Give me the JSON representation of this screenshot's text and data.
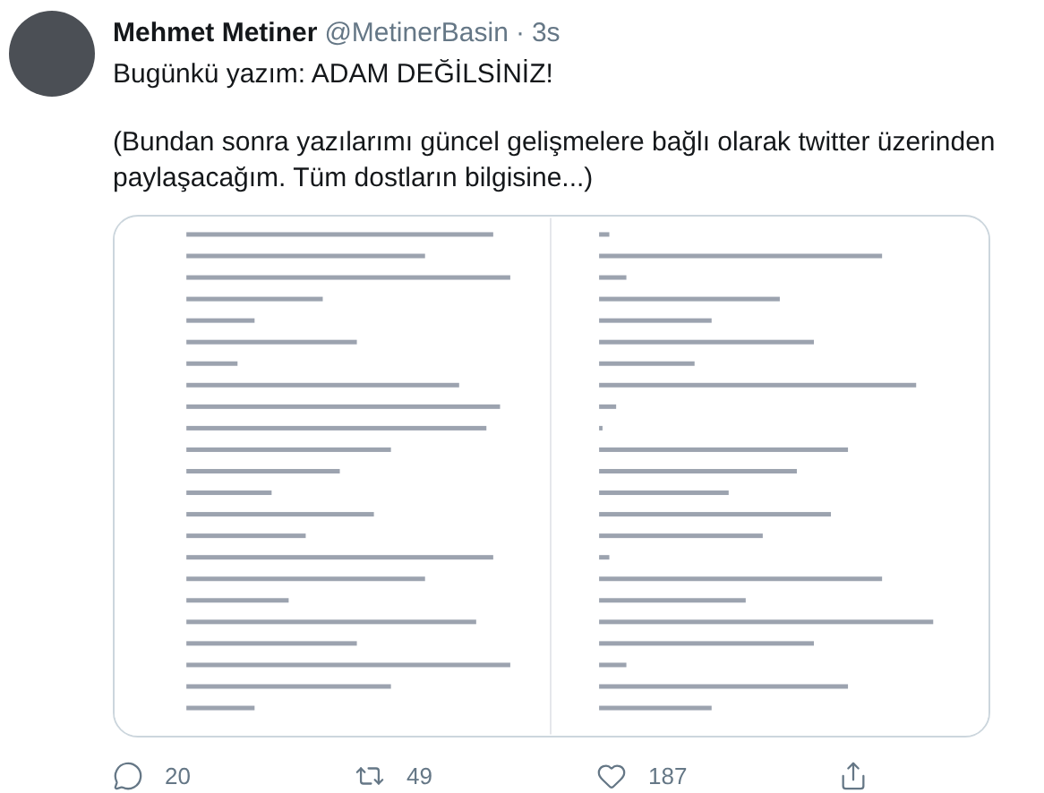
{
  "tweet": {
    "author_name": "Mehmet Metiner",
    "handle": "@MetinerBasin",
    "separator": "·",
    "time": "3s",
    "lines": [
      "Bugünkü yazım: ADAM DEĞİLSİNİZ!",
      "(Bundan sonra yazılarımı güncel gelişmelere bağlı olarak twitter üzerinden paylaşacağım. Tüm dostların bilgisine...)"
    ]
  },
  "actions": [
    {
      "kind": "reply",
      "count": "20"
    },
    {
      "kind": "retweet",
      "count": "49"
    },
    {
      "kind": "like",
      "count": "187"
    },
    {
      "kind": "share"
    }
  ]
}
